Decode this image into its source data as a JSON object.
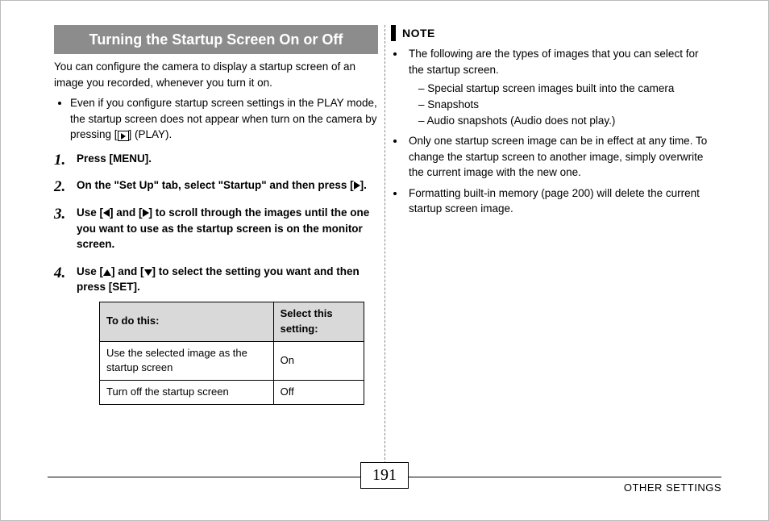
{
  "left": {
    "title": "Turning the Startup Screen On or Off",
    "intro": "You can configure the camera to display a startup screen of an image you recorded, whenever you turn it on.",
    "bullet1a": "Even if you configure startup screen settings in the PLAY mode, the startup screen does not appear when turn on the camera by pressing [",
    "bullet1b": "] (PLAY).",
    "step1": "Press [MENU].",
    "step2a": "On the \"Set Up\" tab, select \"Startup\" and then press [",
    "step2b": "].",
    "step3a": "Use [",
    "step3b": "] and [",
    "step3c": "] to scroll through the images until the one you want to use as the startup screen is on the monitor screen.",
    "step4a": "Use [",
    "step4b": "] and [",
    "step4c": "] to select the setting you want and then press [SET].",
    "table": {
      "h1": "To do this:",
      "h2": "Select this setting:",
      "r1c1": "Use the selected image as the startup screen",
      "r1c2": "On",
      "r2c1": "Turn off the startup screen",
      "r2c2": "Off"
    }
  },
  "right": {
    "note_label": "NOTE",
    "n1": "The following are the types of images that you can select for the startup screen.",
    "n1a": "Special startup screen images built into the camera",
    "n1b": "Snapshots",
    "n1c": "Audio snapshots (Audio does not play.)",
    "n2": "Only one startup screen image can be in effect at any time. To change the startup screen to another image, simply overwrite the current image with the new one.",
    "n3": "Formatting built-in memory (page 200) will delete the current startup screen image."
  },
  "footer": {
    "page": "191",
    "section": "OTHER SETTINGS"
  }
}
